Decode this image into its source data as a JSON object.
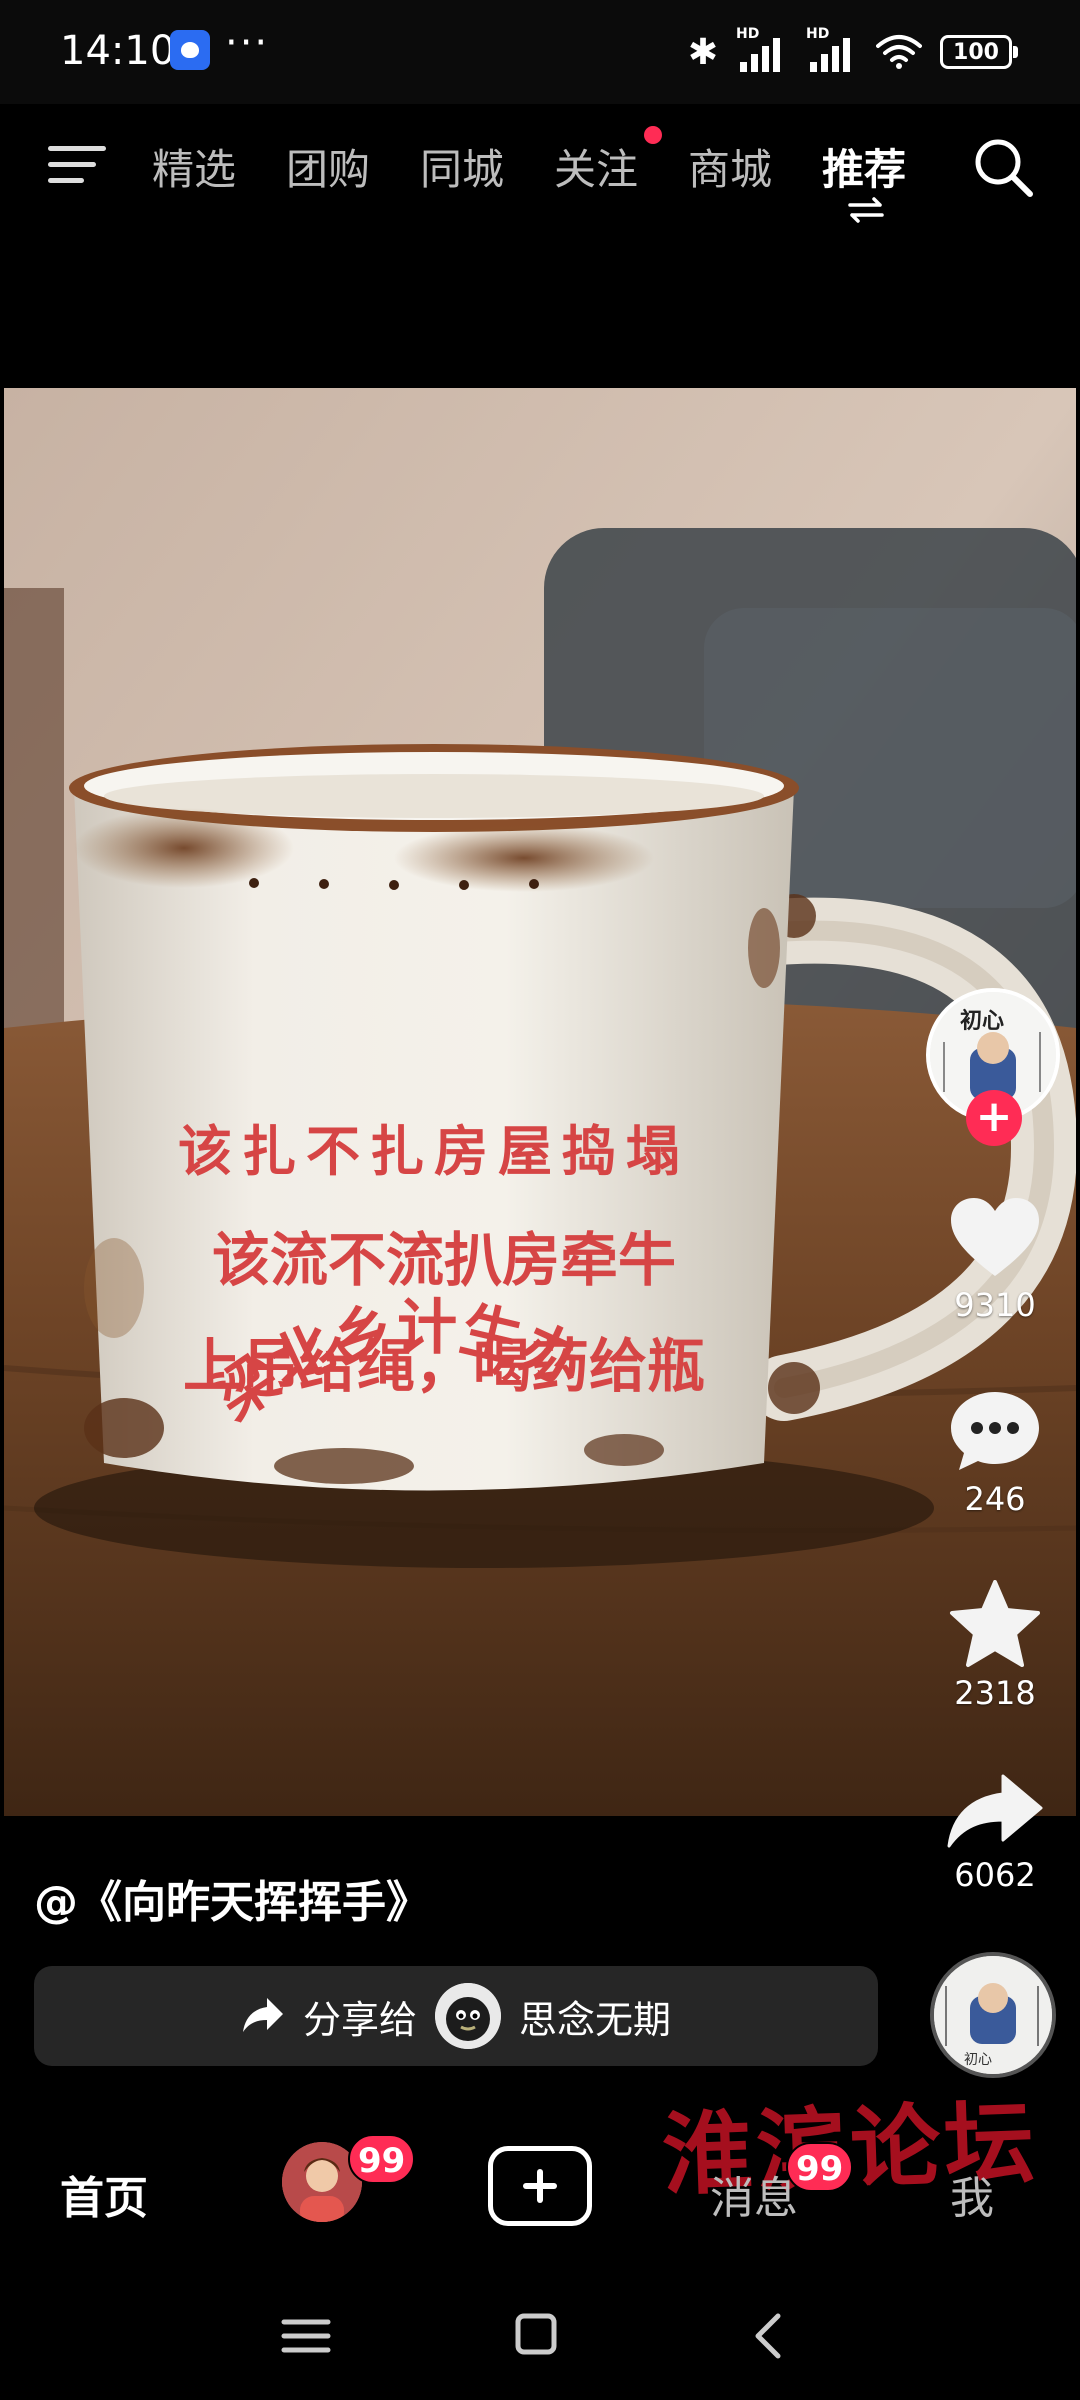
{
  "status_bar": {
    "time": "14:10",
    "more": "···",
    "battery": "100",
    "signal_label_1": "HD",
    "signal_label_2": "HD",
    "icons": [
      "baidu-app-icon",
      "bluetooth-icon",
      "signal-icon",
      "wifi-icon",
      "battery-icon"
    ]
  },
  "top_nav": {
    "tabs": [
      {
        "label": "精选"
      },
      {
        "label": "团购"
      },
      {
        "label": "同城"
      },
      {
        "label": "关注"
      },
      {
        "label": "商城"
      },
      {
        "label": "推荐"
      }
    ],
    "active_tab": "推荐",
    "icons": [
      "menu-icon",
      "swap-icon",
      "search-icon"
    ]
  },
  "post": {
    "image_text": {
      "arc_title": "梁北乡计生办",
      "line1": "该扎不扎房屋捣塌",
      "line2": "该流不流扒房牵牛",
      "line3": "上吊给绳，喝药给瓶"
    },
    "author": "@《向昨天挥挥手》",
    "share": {
      "label": "分享给",
      "friend": "思念无期"
    }
  },
  "actions": {
    "likes": "9310",
    "comments": "246",
    "favorites": "2318",
    "shares": "6062"
  },
  "tab_bar": {
    "home": "首页",
    "friends_badge": "99",
    "messages": "消息",
    "messages_badge": "99",
    "me": "我"
  },
  "watermark": "淮滨论坛",
  "colors": {
    "accent_red": "#ff2c55",
    "mug_text_red": "#d64545"
  }
}
